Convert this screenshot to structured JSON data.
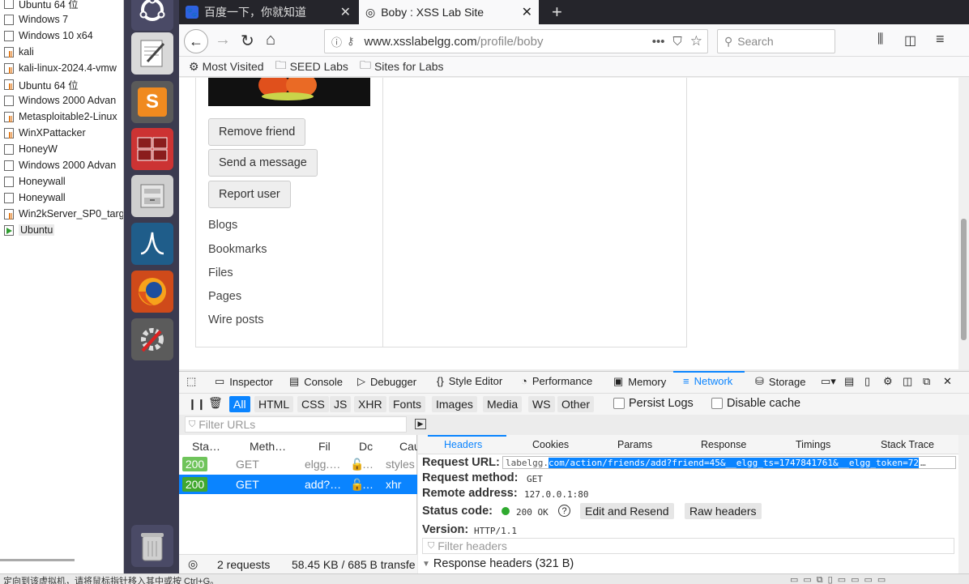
{
  "vm_list": {
    "items": [
      {
        "label": "Ubuntu 64 位",
        "icon": "vm-icon"
      },
      {
        "label": "Windows 7",
        "icon": "vm-icon"
      },
      {
        "label": "Windows 10 x64",
        "icon": "vm-icon"
      },
      {
        "label": "kali",
        "icon": "vm-bars-icon"
      },
      {
        "label": "kali-linux-2024.4-vmw",
        "icon": "vm-bars-icon"
      },
      {
        "label": "Ubuntu 64 位",
        "icon": "vm-bars-icon"
      },
      {
        "label": "Windows 2000 Advan",
        "icon": "vm-icon"
      },
      {
        "label": "Metasploitable2-Linux",
        "icon": "vm-bars-icon"
      },
      {
        "label": "WinXPattacker",
        "icon": "vm-bars-icon"
      },
      {
        "label": "HoneyW",
        "icon": "vm-icon"
      },
      {
        "label": "Windows 2000 Advan",
        "icon": "vm-icon"
      },
      {
        "label": "Honeywall",
        "icon": "vm-icon"
      },
      {
        "label": "Honeywall",
        "icon": "vm-icon"
      },
      {
        "label": "Win2kServer_SP0_targ",
        "icon": "vm-bars-icon"
      },
      {
        "label": "Ubuntu",
        "icon": "vm-running-icon"
      }
    ]
  },
  "browser": {
    "tabs": [
      {
        "label": "百度一下，你就知道",
        "icon": "paw-icon"
      },
      {
        "label": "Boby : XSS Lab Site",
        "icon": "globe-icon"
      }
    ],
    "new_tab": "+",
    "url_domain": "www.xsslabelgg.com",
    "url_path": "/profile/boby",
    "url_menu": "•••",
    "search_placeholder": "Search",
    "bookmarks": [
      {
        "label": "Most Visited",
        "icon": "gear-icon"
      },
      {
        "label": "SEED Labs",
        "icon": "folder-icon"
      },
      {
        "label": "Sites for Labs",
        "icon": "folder-icon"
      }
    ]
  },
  "profile": {
    "buttons": [
      "Remove friend",
      "Send a message",
      "Report user"
    ],
    "menu": [
      "Blogs",
      "Bookmarks",
      "Files",
      "Pages",
      "Wire posts"
    ]
  },
  "devtools": {
    "tools": [
      "Inspector",
      "Console",
      "Debugger",
      "Style Editor",
      "Performance",
      "Memory",
      "Network",
      "Storage"
    ],
    "active_tool": "Network",
    "filter_types": [
      "All",
      "HTML",
      "CSS",
      "JS",
      "XHR",
      "Fonts",
      "Images",
      "Media",
      "WS",
      "Other"
    ],
    "persist_logs": "Persist Logs",
    "disable_cache": "Disable cache",
    "filter_urls_placeholder": "Filter URLs",
    "columns": [
      "Sta…",
      "Meth…",
      "Fil",
      "Dc",
      "Cau"
    ],
    "requests": [
      {
        "status": "200",
        "method": "GET",
        "file": "elgg.…",
        "domain": "…",
        "cause": "styles"
      },
      {
        "status": "200",
        "method": "GET",
        "file": "add?…",
        "domain": "…",
        "cause": "xhr"
      }
    ],
    "detail_tabs": [
      "Headers",
      "Cookies",
      "Params",
      "Response",
      "Timings",
      "Stack Trace"
    ],
    "request_url_label": "Request URL:",
    "request_url_prefix": "labelgg.",
    "request_url_highlight": "com/action/friends/add?friend=45&__elgg_ts=1747841761&__elgg_token=72",
    "request_url_ellipsis": "…",
    "request_method_label": "Request method:",
    "request_method": "GET",
    "remote_address_label": "Remote address:",
    "remote_address": "127.0.0.1:80",
    "status_code_label": "Status code:",
    "status_code": "200 OK",
    "edit_resend": "Edit and Resend",
    "raw_headers": "Raw headers",
    "version_label": "Version:",
    "version": "HTTP/1.1",
    "filter_headers_placeholder": "Filter headers",
    "summary_requests": "2 requests",
    "summary_size": "58.45 KB / 685 B transfe",
    "response_headers": "Response headers (321 B)"
  },
  "vm_status": "定向到该虚拟机，请将鼠标指针移入其中或按 Ctrl+G。",
  "colors": {
    "accent": "#0a84ff",
    "status_ok": "#6fc45b",
    "launcher": "#3b3b50",
    "tabbar": "#25252b"
  }
}
